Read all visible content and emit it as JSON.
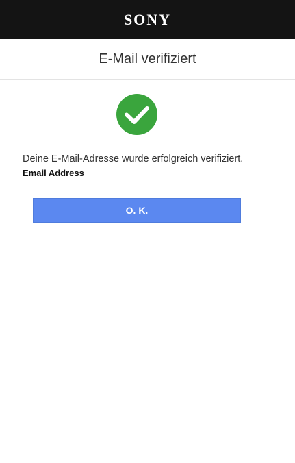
{
  "header": {
    "logo_text": "SONY"
  },
  "page": {
    "title": "E-Mail verifiziert"
  },
  "status": {
    "icon": "check-circle-icon",
    "color": "#3aa53d",
    "message": "Deine E-Mail-Adresse wurde erfolgreich verifiziert.",
    "email_label": "Email Address"
  },
  "actions": {
    "ok_label": "O. K.",
    "ok_color": "#5b88f0"
  }
}
